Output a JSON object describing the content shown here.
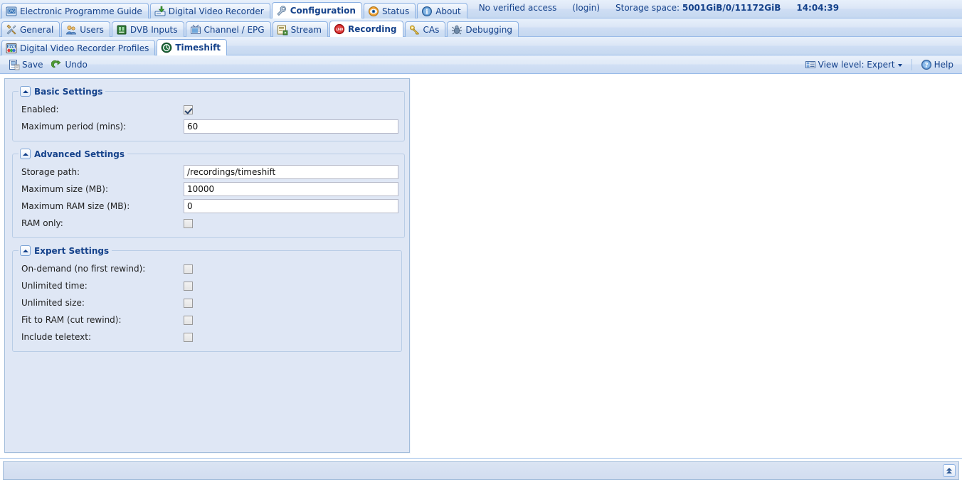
{
  "topnav": {
    "tabs": [
      {
        "label": "Electronic Programme Guide",
        "icon": "epg-icon",
        "active": false
      },
      {
        "label": "Digital Video Recorder",
        "icon": "dvr-icon",
        "active": false
      },
      {
        "label": "Configuration",
        "icon": "wrench-icon",
        "active": true
      },
      {
        "label": "Status",
        "icon": "eye-icon",
        "active": false
      },
      {
        "label": "About",
        "icon": "info-icon",
        "active": false
      }
    ],
    "access_text": "No verified access",
    "login_label": "(login)",
    "storage_label": "Storage space:",
    "storage_value": "5001GiB/0/11172GiB",
    "clock": "14:04:39"
  },
  "subnav": {
    "tabs": [
      {
        "label": "General",
        "icon": "tools-icon",
        "active": false
      },
      {
        "label": "Users",
        "icon": "users-icon",
        "active": false
      },
      {
        "label": "DVB Inputs",
        "icon": "card-icon",
        "active": false
      },
      {
        "label": "Channel / EPG",
        "icon": "tv-icon",
        "active": false
      },
      {
        "label": "Stream",
        "icon": "stream-icon",
        "active": false
      },
      {
        "label": "Recording",
        "icon": "rec-icon",
        "active": true
      },
      {
        "label": "CAs",
        "icon": "key-icon",
        "active": false
      },
      {
        "label": "Debugging",
        "icon": "bug-icon",
        "active": false
      }
    ]
  },
  "tabnav": {
    "tabs": [
      {
        "label": "Digital Video Recorder Profiles",
        "icon": "dvr-profile-icon",
        "active": false
      },
      {
        "label": "Timeshift",
        "icon": "timeshift-icon",
        "active": true
      }
    ]
  },
  "toolbar": {
    "save_label": "Save",
    "undo_label": "Undo",
    "view_level_label": "View level: Expert",
    "help_label": "Help"
  },
  "form": {
    "groups": [
      {
        "title": "Basic Settings",
        "fields": [
          {
            "label": "Enabled:",
            "type": "checkbox",
            "checked": true
          },
          {
            "label": "Maximum period (mins):",
            "type": "text",
            "value": "60"
          }
        ]
      },
      {
        "title": "Advanced Settings",
        "fields": [
          {
            "label": "Storage path:",
            "type": "text",
            "value": "/recordings/timeshift"
          },
          {
            "label": "Maximum size (MB):",
            "type": "text",
            "value": "10000"
          },
          {
            "label": "Maximum RAM size (MB):",
            "type": "text",
            "value": "0"
          },
          {
            "label": "RAM only:",
            "type": "checkbox",
            "checked": false
          }
        ]
      },
      {
        "title": "Expert Settings",
        "fields": [
          {
            "label": "On-demand (no first rewind):",
            "type": "checkbox",
            "checked": false
          },
          {
            "label": "Unlimited time:",
            "type": "checkbox",
            "checked": false
          },
          {
            "label": "Unlimited size:",
            "type": "checkbox",
            "checked": false
          },
          {
            "label": "Fit to RAM (cut rewind):",
            "type": "checkbox",
            "checked": false
          },
          {
            "label": "Include teletext:",
            "type": "checkbox",
            "checked": false
          }
        ]
      }
    ]
  },
  "colors": {
    "accent": "#15428b",
    "panel": "#dfe7f5",
    "border": "#99bbe8"
  }
}
